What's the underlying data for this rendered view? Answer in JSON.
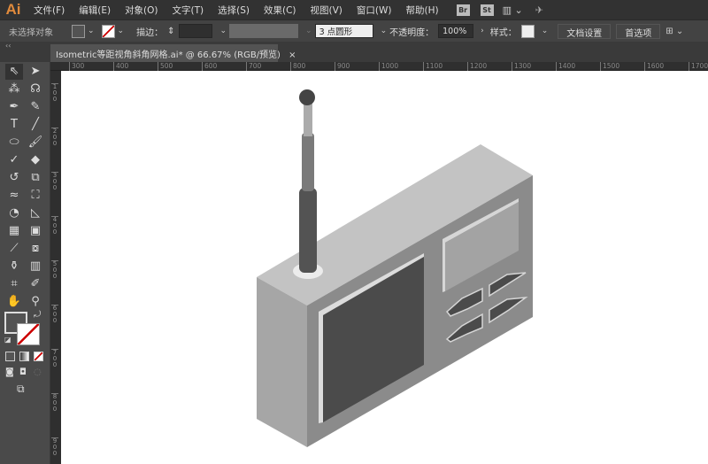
{
  "app": {
    "logo": "Ai"
  },
  "menu": [
    "文件(F)",
    "编辑(E)",
    "对象(O)",
    "文字(T)",
    "选择(S)",
    "效果(C)",
    "视图(V)",
    "窗口(W)",
    "帮助(H)"
  ],
  "menu_icons": {
    "bridge": "Br",
    "stock": "St"
  },
  "control": {
    "selection": "未选择对象",
    "stroke_label": "描边：",
    "brush": "3 点圆形",
    "opacity_label": "不透明度：",
    "opacity": "100%",
    "style_label": "样式：",
    "doc_setup": "文档设置",
    "prefs": "首选项"
  },
  "tab": {
    "title": "Isometric等距视角斜角网格.ai* @ 66.67% (RGB/预览)",
    "close": "×"
  },
  "ruler_h": [
    "300",
    "400",
    "500",
    "600",
    "700",
    "800",
    "900",
    "1000",
    "1100",
    "1200",
    "1300",
    "1400",
    "1500",
    "1600",
    "1700"
  ],
  "ruler_v": [
    "100",
    "200",
    "300",
    "400",
    "500",
    "600",
    "700",
    "800",
    "900"
  ],
  "colors": {
    "top": "#c3c3c3",
    "left": "#a6a6a6",
    "front": "#8b8b8b",
    "speaker": "#4b4b4b",
    "display": "#a3a3a3",
    "accent": "#e08a3c"
  }
}
